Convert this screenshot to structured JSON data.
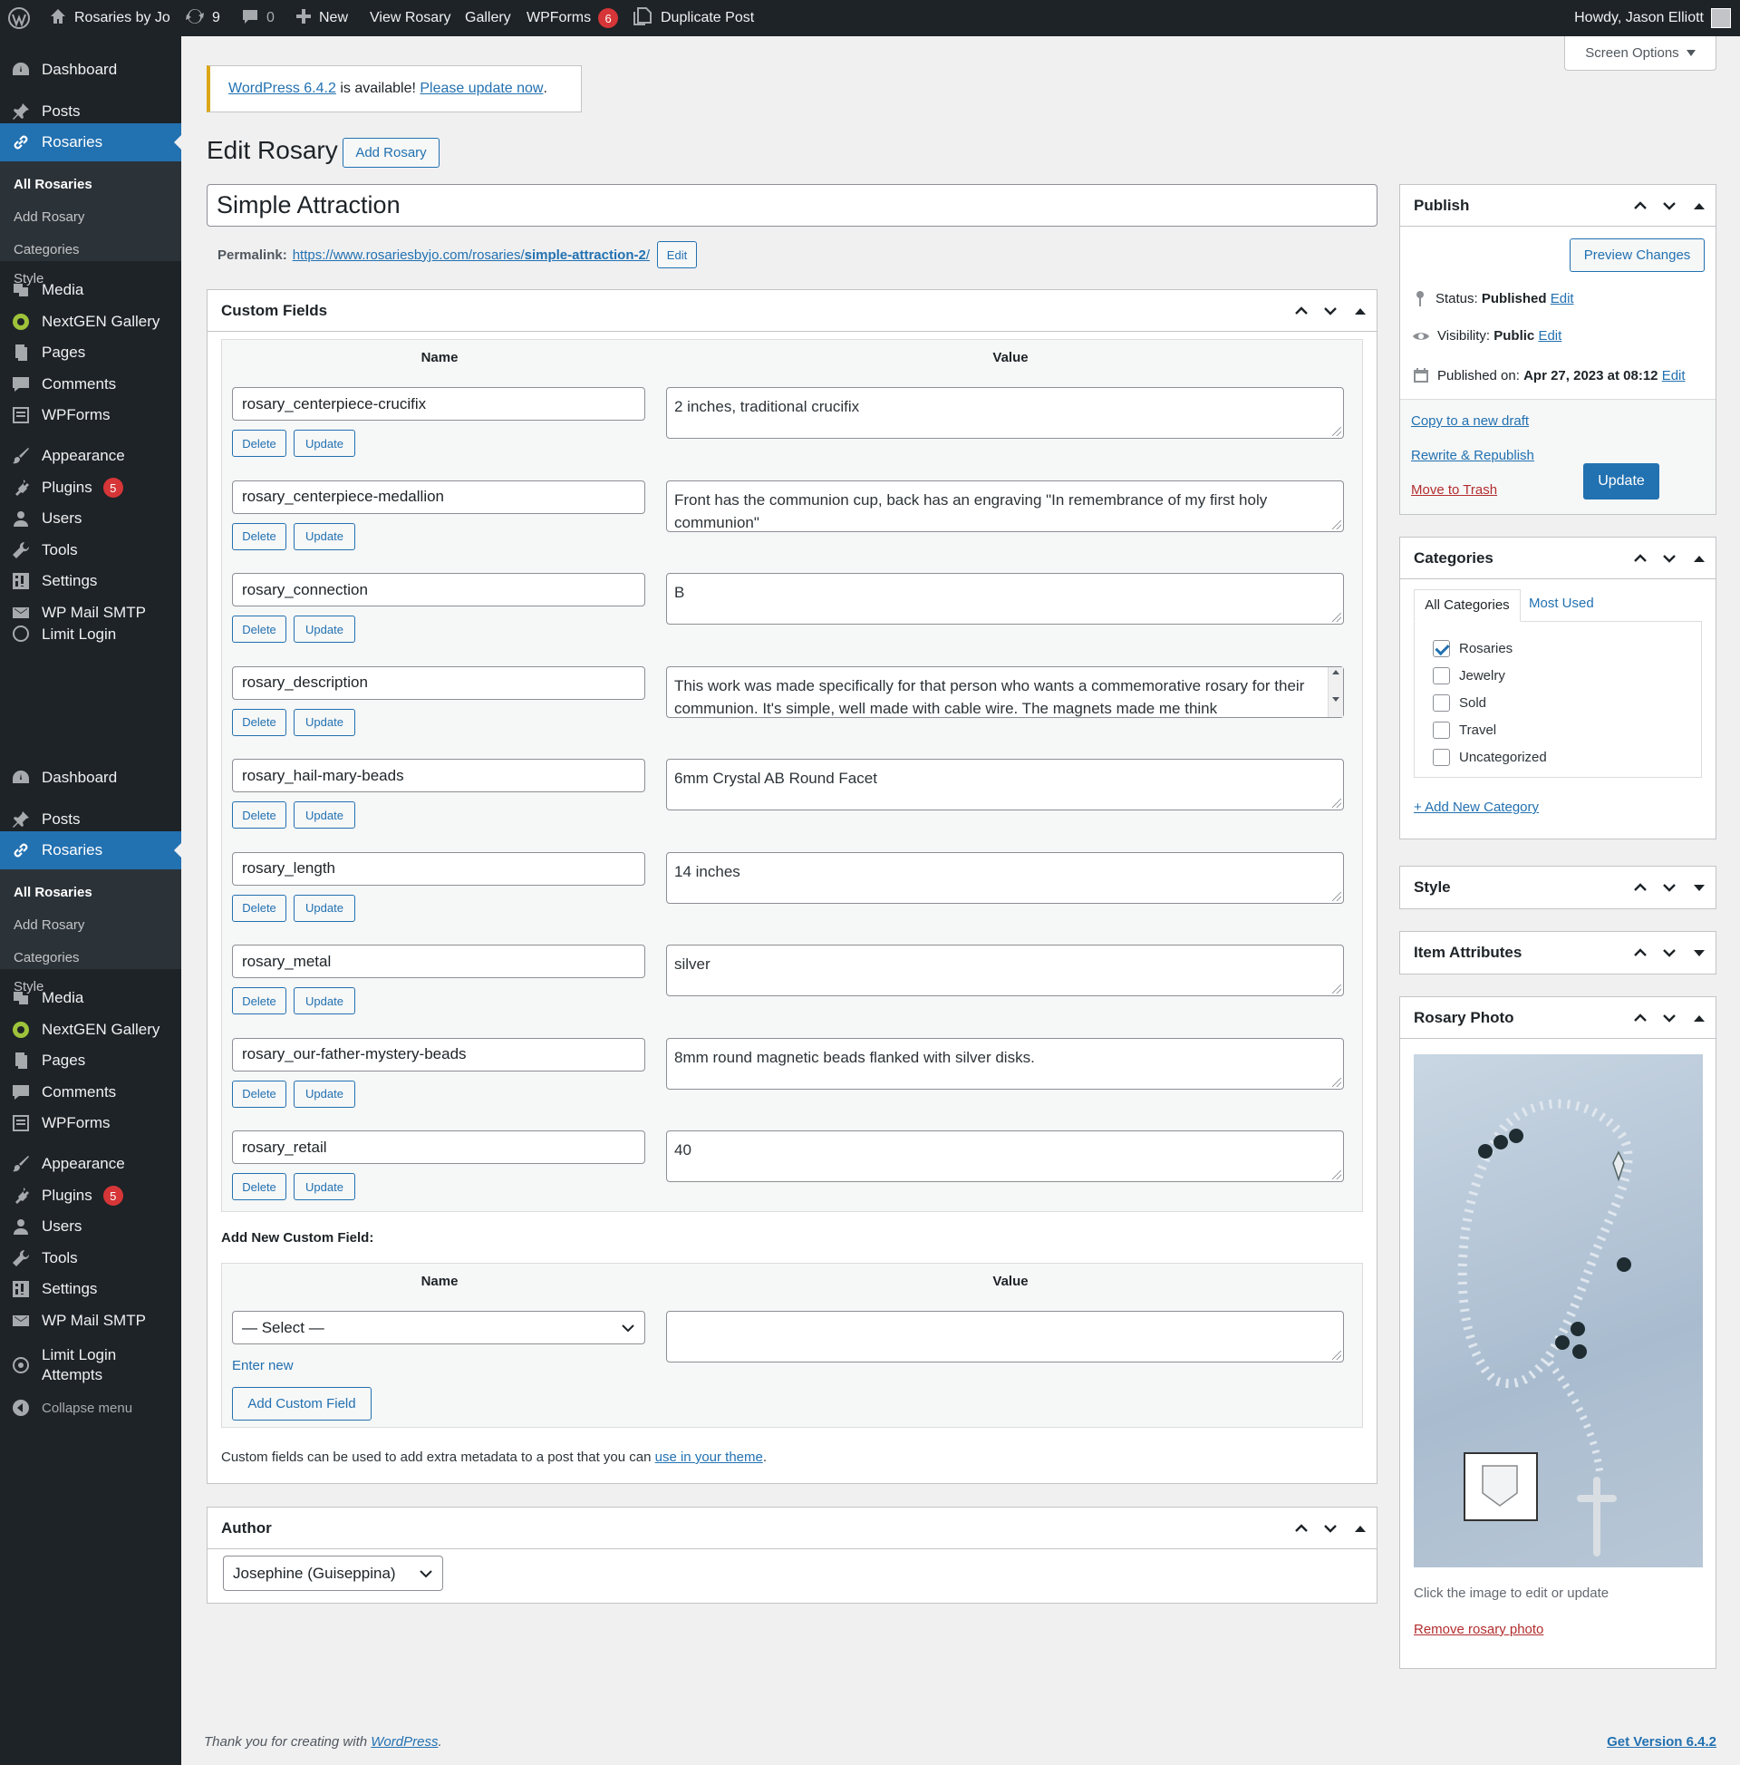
{
  "adminbar": {
    "site": "Rosaries by Jo",
    "updates": "9",
    "comments": "0",
    "new": "New",
    "view": "View Rosary",
    "gallery": "Gallery",
    "wpforms": "WPForms",
    "wpforms_badge": "6",
    "duplicate": "Duplicate Post",
    "howdy": "Howdy, Jason Elliott"
  },
  "sidebar": {
    "dashboard": "Dashboard",
    "posts": "Posts",
    "rosaries": "Rosaries",
    "sub": [
      "All Rosaries",
      "Add Rosary",
      "Categories",
      "Style"
    ],
    "media": "Media",
    "nextgen": "NextGEN Gallery",
    "pages": "Pages",
    "comments": "Comments",
    "wpforms": "WPForms",
    "appearance": "Appearance",
    "plugins": "Plugins",
    "plugins_badge": "5",
    "users": "Users",
    "tools": "Tools",
    "settings": "Settings",
    "smtp": "WP Mail SMTP",
    "limit": "Limit Login",
    "limit2": "Attempts",
    "collapse": "Collapse menu"
  },
  "screen_options": "Screen Options",
  "notice": {
    "version_link": "WordPress 6.4.2",
    "text": " is available! ",
    "update_link": "Please update now",
    "end": "."
  },
  "heading": {
    "title": "Edit Rosary",
    "add": "Add Rosary"
  },
  "post_title": "Simple Attraction",
  "permalink": {
    "label": "Permalink:",
    "url_base": "https://www.rosariesbyjo.com/rosaries/",
    "slug": "simple-attraction-2",
    "url_end": "/",
    "edit": "Edit"
  },
  "custom_fields": {
    "title": "Custom Fields",
    "col_name": "Name",
    "col_value": "Value",
    "delete": "Delete",
    "update": "Update",
    "rows": [
      {
        "name": "rosary_centerpiece-crucifix",
        "value": "2 inches, traditional crucifix"
      },
      {
        "name": "rosary_centerpiece-medallion",
        "value": "Front has the communion cup, back has an engraving \"In remembrance of my first holy communion\""
      },
      {
        "name": "rosary_connection",
        "value": "B"
      },
      {
        "name": "rosary_description",
        "value": "This work was made specifically for that person who wants a commemorative rosary for their communion.  It's simple, well made with cable wire.  The magnets made me think"
      },
      {
        "name": "rosary_hail-mary-beads",
        "value": "6mm Crystal AB Round Facet"
      },
      {
        "name": "rosary_length",
        "value": "14 inches"
      },
      {
        "name": "rosary_metal",
        "value": "silver"
      },
      {
        "name": "rosary_our-father-mystery-beads",
        "value": "8mm round magnetic beads flanked with silver disks."
      },
      {
        "name": "rosary_retail",
        "value": "40"
      }
    ],
    "add_new_label": "Add New Custom Field:",
    "select": "— Select —",
    "enter_new": "Enter new",
    "add_button": "Add Custom Field",
    "help_text": "Custom fields can be used to add extra metadata to a post that you can ",
    "help_link": "use in your theme",
    "help_end": "."
  },
  "author": {
    "title": "Author",
    "value": "Josephine (Guiseppina)"
  },
  "publish": {
    "title": "Publish",
    "preview": "Preview Changes",
    "status_label": "Status: ",
    "status": "Published",
    "visibility_label": "Visibility: ",
    "visibility": "Public",
    "published_label": "Published on: ",
    "published": "Apr 27, 2023 at 08:12",
    "edit": "Edit",
    "copy": "Copy to a new draft",
    "rewrite": "Rewrite & Republish",
    "trash": "Move to Trash",
    "update": "Update"
  },
  "categories": {
    "title": "Categories",
    "tab_all": "All Categories",
    "tab_used": "Most Used",
    "items": [
      {
        "label": "Rosaries",
        "checked": true
      },
      {
        "label": "Jewelry",
        "checked": false
      },
      {
        "label": "Sold",
        "checked": false
      },
      {
        "label": "Travel",
        "checked": false
      },
      {
        "label": "Uncategorized",
        "checked": false
      }
    ],
    "add": "+ Add New Category"
  },
  "style_box": "Style",
  "item_attributes": "Item Attributes",
  "photo": {
    "title": "Rosary Photo",
    "hint": "Click the image to edit or update",
    "remove": "Remove rosary photo"
  },
  "footer": {
    "thanks": "Thank you for creating with ",
    "wp": "WordPress",
    "end": ".",
    "version": "Get Version 6.4.2"
  },
  "colors": {
    "primary": "#2271b1",
    "adminbar": "#1d2327",
    "trash": "#b32d2e",
    "badge": "#d63638"
  }
}
